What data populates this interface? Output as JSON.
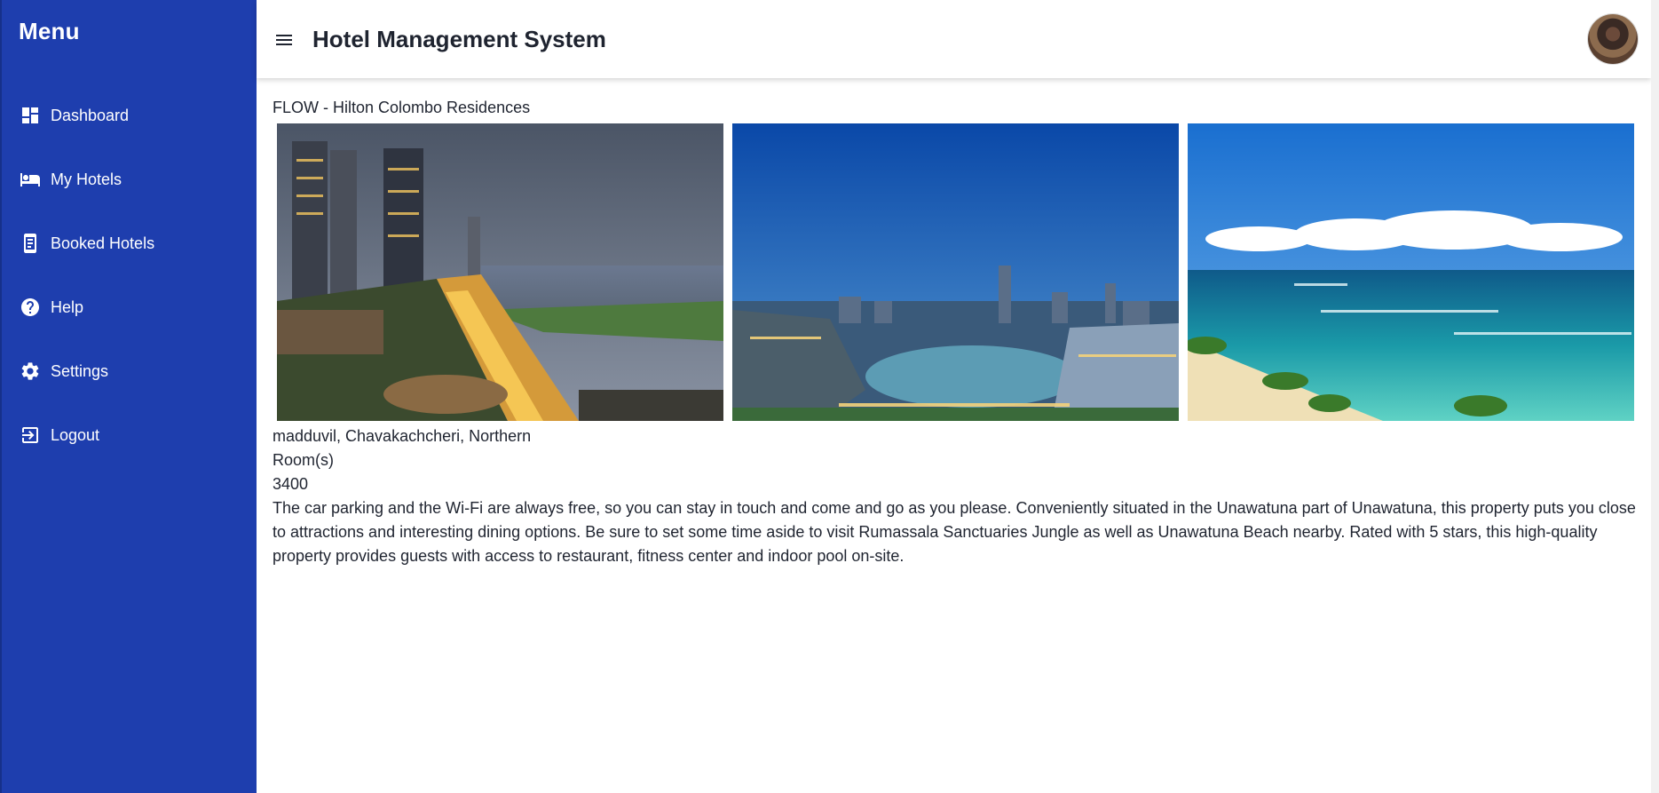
{
  "sidebar": {
    "title": "Menu",
    "items": [
      {
        "label": "Dashboard",
        "icon": "dashboard-icon"
      },
      {
        "label": "My Hotels",
        "icon": "bed-icon"
      },
      {
        "label": "Booked Hotels",
        "icon": "booked-icon"
      },
      {
        "label": "Help",
        "icon": "help-icon"
      },
      {
        "label": "Settings",
        "icon": "gear-icon"
      },
      {
        "label": "Logout",
        "icon": "logout-icon"
      }
    ],
    "background": "#1e3eae"
  },
  "header": {
    "title": "Hotel Management System",
    "menu_icon": "hamburger-icon",
    "avatar_icon": "user-avatar"
  },
  "hotel": {
    "name": "FLOW - Hilton Colombo Residences",
    "photos": [
      "colombo-waterfront-night-photo",
      "colombo-lake-skyline-photo",
      "unawatuna-beach-photo"
    ],
    "address": "madduvil, Chavakachcheri, Northern",
    "rooms_label": "Room(s)",
    "rooms_value": "3400",
    "description": "The car parking and the Wi-Fi are always free, so you can stay in touch and come and go as you please. Conveniently situated in the Unawatuna part of Unawatuna, this property puts you close to attractions and interesting dining options. Be sure to set some time aside to visit Rumassala Sanctuaries Jungle as well as Unawatuna Beach nearby. Rated with 5 stars, this high-quality property provides guests with access to restaurant, fitness center and indoor pool on-site."
  }
}
